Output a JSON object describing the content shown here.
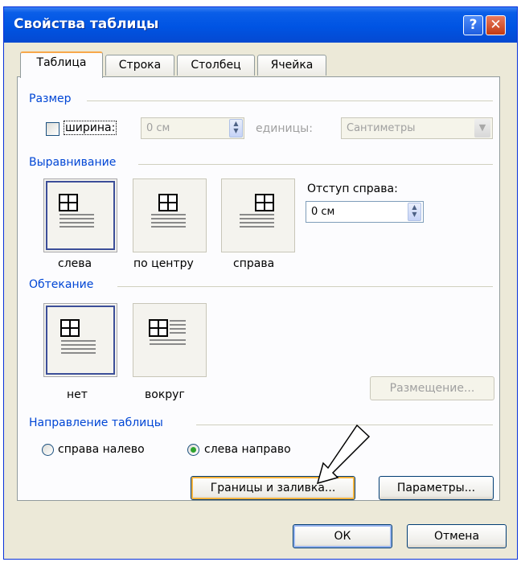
{
  "window": {
    "title": "Свойства таблицы",
    "help_symbol": "?",
    "close_symbol": "✕"
  },
  "tabs": [
    {
      "label": "Таблица",
      "active": true
    },
    {
      "label": "Строка",
      "active": false
    },
    {
      "label": "Столбец",
      "active": false
    },
    {
      "label": "Ячейка",
      "active": false
    }
  ],
  "size": {
    "group": "Размер",
    "width_label": "ширина:",
    "width_checked": false,
    "width_value": "0 см",
    "units_label": "единицы:",
    "units_value": "Сантиметры"
  },
  "alignment": {
    "group": "Выравнивание",
    "options": [
      "слева",
      "по центру",
      "справа"
    ],
    "selected": "слева",
    "indent_label": "Отступ справа:",
    "indent_value": "0 см"
  },
  "wrapping": {
    "group": "Обтекание",
    "options": [
      "нет",
      "вокруг"
    ],
    "selected": "нет",
    "position_button": "Размещение..."
  },
  "direction": {
    "group": "Направление таблицы",
    "options": [
      "справа налево",
      "слева направо"
    ],
    "selected": "слева направо"
  },
  "buttons": {
    "borders": "Границы и заливка...",
    "options": "Параметры...",
    "ok": "ОК",
    "cancel": "Отмена"
  },
  "colors": {
    "title_bar": "#0054e3",
    "group_label": "#0046d5",
    "tab_highlight": "#f7a84b",
    "radio_dot": "#2fa32f"
  }
}
